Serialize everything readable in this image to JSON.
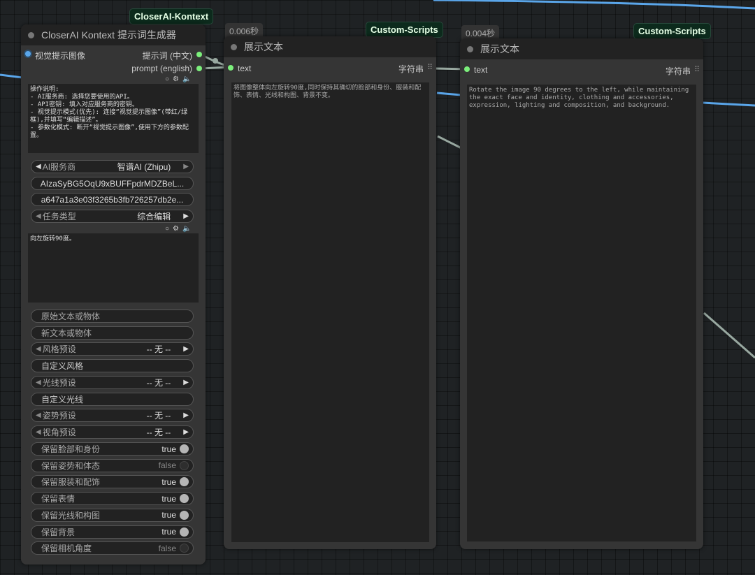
{
  "colors": {
    "link_blue": "#5aa6ea",
    "link_grey": "#98a8a0",
    "slot_green": "#7cf07c",
    "badge_bg": "#0c2a1c"
  },
  "node1": {
    "badge": "CloserAI-Kontext",
    "title": "CloserAI Kontext 提示词生成器",
    "input_label": "视觉提示图像",
    "output_cn": "提示词 (中文)",
    "output_en": "prompt (english)",
    "instructions": "操作说明:\n- AI服务商: 选择您要使用的API。\n- API密钥: 填入对应服务商的密钥。\n- 视觉提示模式(优先): 连接“视觉提示图像”(带红/绿框),并填写“编辑描述”。\n- 参数化模式: 断开“视觉提示图像”,使用下方的参数配置。",
    "provider_label": "AI服务商",
    "provider_value": "智谱AI (Zhipu)",
    "api_key": "AIzaSyBG5OqU9xBUFFpdrMDZBeL...",
    "api_key2": "a647a1a3e03f3265b3fb726257db2e...",
    "task_label": "任务类型",
    "task_value": "综合编辑",
    "edit_text": "向左旋转90度。",
    "original_obj": "原始文本或物体",
    "new_obj": "新文本或物体",
    "style_label": "风格预设",
    "style_value": "-- 无 --",
    "custom_style": "自定义风格",
    "light_label": "光线预设",
    "light_value": "-- 无 --",
    "custom_light": "自定义光线",
    "pose_label": "姿势预设",
    "pose_value": "-- 无 --",
    "view_label": "视角预设",
    "view_value": "-- 无 --",
    "toggles": [
      {
        "label": "保留脸部和身份",
        "value": "true",
        "on": true
      },
      {
        "label": "保留姿势和体态",
        "value": "false",
        "on": false
      },
      {
        "label": "保留服装和配饰",
        "value": "true",
        "on": true
      },
      {
        "label": "保留表情",
        "value": "true",
        "on": true
      },
      {
        "label": "保留光线和构图",
        "value": "true",
        "on": true
      },
      {
        "label": "保留背景",
        "value": "true",
        "on": true
      },
      {
        "label": "保留相机角度",
        "value": "false",
        "on": false
      }
    ]
  },
  "node2": {
    "timer": "0.006秒",
    "badge": "Custom-Scripts",
    "title": "展示文本",
    "input": "text",
    "output": "字符串",
    "text": "将图像整体向左旋转90度,同时保持其确切的脸部和身份、服装和配饰、表情、光线和构图、背景不变。"
  },
  "node3": {
    "timer": "0.004秒",
    "badge": "Custom-Scripts",
    "title": "展示文本",
    "input": "text",
    "output": "字符串",
    "text": "Rotate the image 90 degrees to the left, while maintaining the exact face and identity, clothing and accessories, expression, lighting and composition, and background."
  }
}
